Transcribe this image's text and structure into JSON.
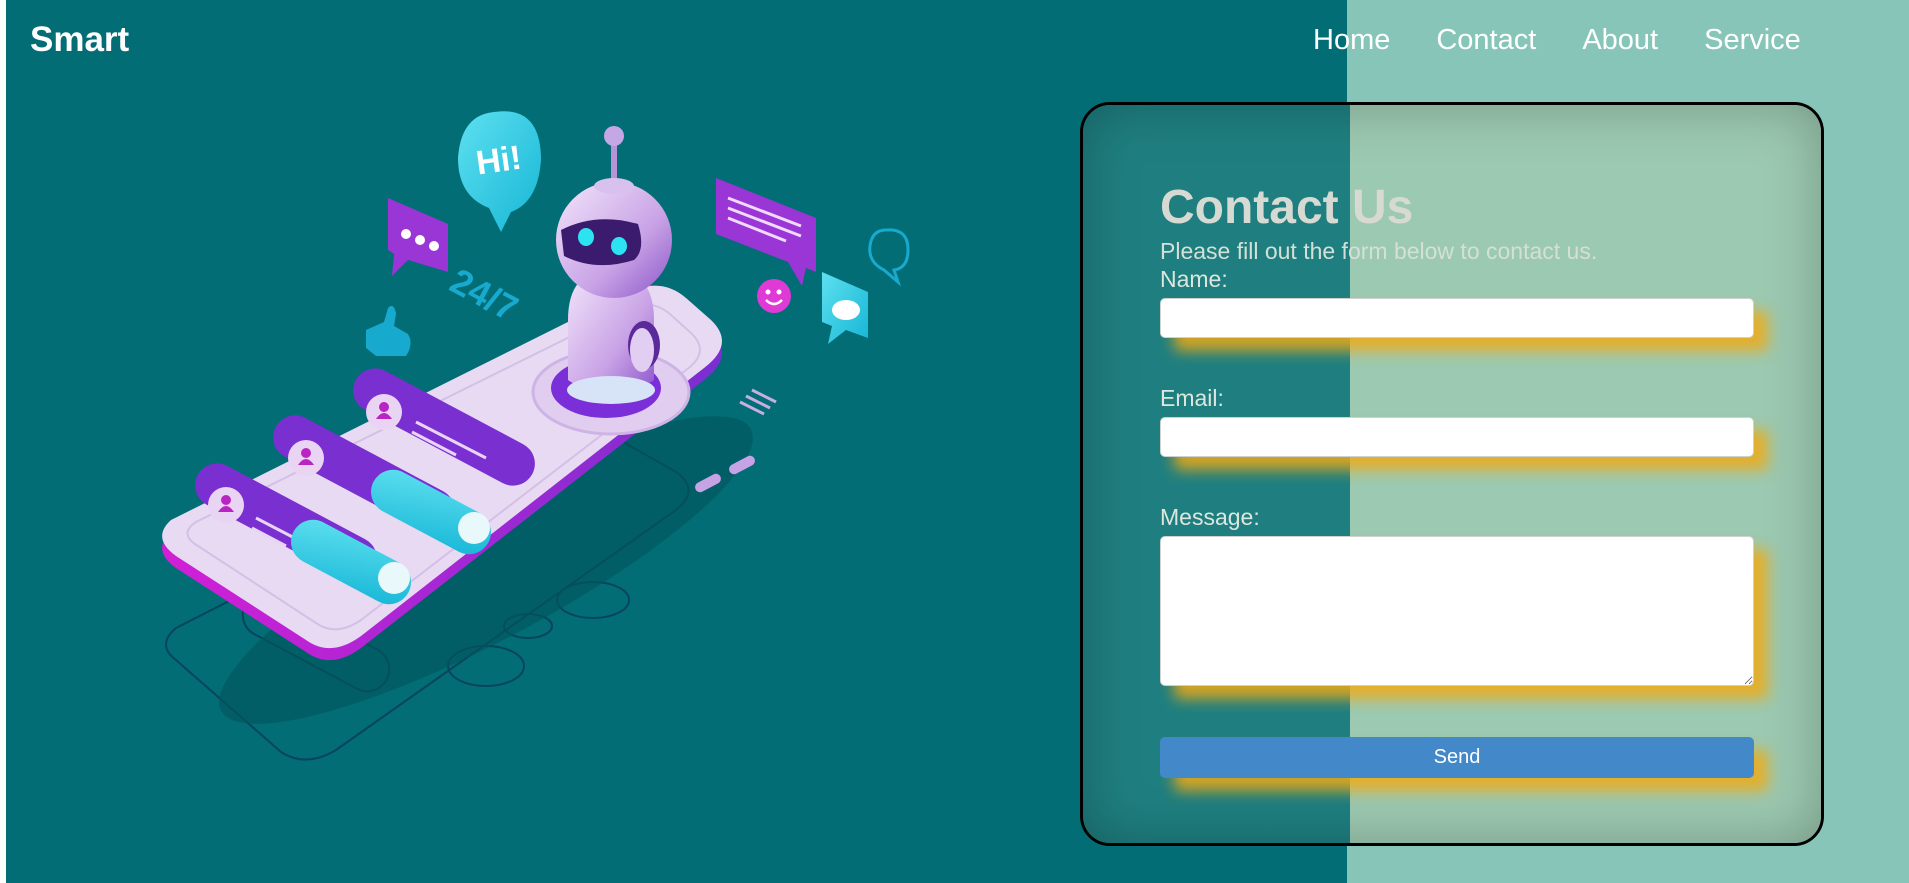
{
  "header": {
    "brand": "Smart",
    "nav": [
      {
        "label": "Home"
      },
      {
        "label": "Contact"
      },
      {
        "label": "About"
      },
      {
        "label": "Service"
      }
    ]
  },
  "illustration": {
    "speech_bubble_text": "Hi!",
    "availability_text": "24/7"
  },
  "contact_form": {
    "title": "Contact Us",
    "subtitle": "Please fill out the form below to contact us.",
    "fields": [
      {
        "label": "Name:",
        "value": "",
        "placeholder": ""
      },
      {
        "label": "Email:",
        "value": "",
        "placeholder": ""
      },
      {
        "label": "Message:",
        "value": "",
        "placeholder": ""
      }
    ],
    "submit_label": "Send"
  },
  "colors": {
    "background": "#026d75",
    "right_panel": "#87c5b8",
    "input_glow": "#f1aa14",
    "send_button": "#4389c9"
  }
}
